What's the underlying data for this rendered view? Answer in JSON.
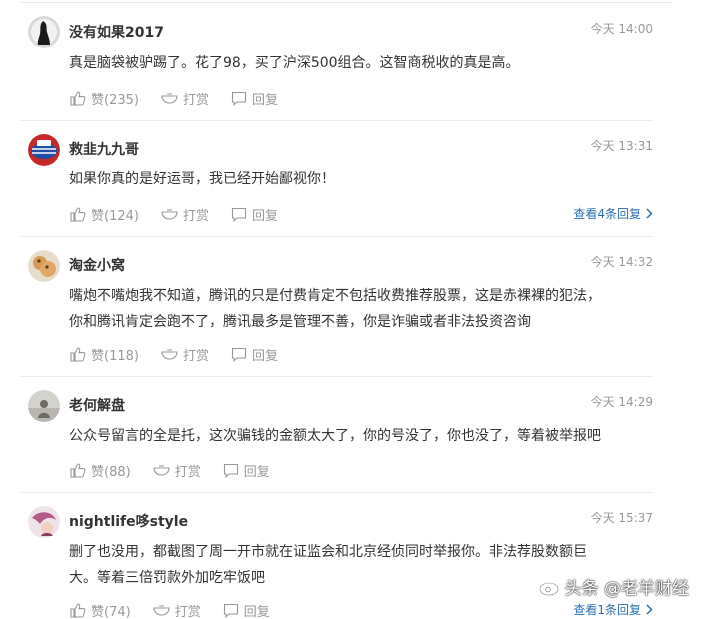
{
  "comments": [
    {
      "username": "没有如果2017",
      "time": "今天 14:00",
      "content": "真是脑袋被驴踢了。花了98，买了沪深500组合。这智商税收的真是高。",
      "like_label": "赞(235)",
      "reward_label": "打赏",
      "reply_label": "回复"
    },
    {
      "username": "救韭九九哥",
      "time": "今天 13:31",
      "content": "如果你真的是好运哥，我已经开始鄙视你！",
      "like_label": "赞(124)",
      "reward_label": "打赏",
      "reply_label": "回复",
      "view_replies": "查看4条回复"
    },
    {
      "username": "淘金小窝",
      "time": "今天 14:32",
      "content_lines": [
        "嘴炮不嘴炮我不知道，腾讯的只是付费肯定不包括收费推荐股票，这是赤裸裸的犯法，",
        "你和腾讯肯定会跑不了，腾讯最多是管理不善，你是诈骗或者非法投资咨询"
      ],
      "like_label": "赞(118)",
      "reward_label": "打赏",
      "reply_label": "回复"
    },
    {
      "username": "老何解盘",
      "time": "今天 14:29",
      "content": "公众号留言的全是托，这次骗钱的金额太大了，你的号没了，你也没了，等着被举报吧",
      "like_label": "赞(88)",
      "reward_label": "打赏",
      "reply_label": "回复"
    },
    {
      "username": "nightlife哆style",
      "time": "今天 15:37",
      "content_lines": [
        "删了也没用，都截图了周一开市就在证监会和北京经侦同时举报你。非法荐股数额巨",
        "大。等着三倍罚款外加吃牢饭吧"
      ],
      "like_label": "赞(74)",
      "reward_label": "打赏",
      "reply_label": "回复",
      "view_replies": "查看1条回复"
    }
  ],
  "watermark": {
    "text": "头条 @老羊财经"
  },
  "icons": {
    "like": "thumbs-up-icon",
    "reward": "tip-bowl-icon",
    "reply": "speech-bubble-icon",
    "arrow": "chevron-right-icon",
    "watermark": "weibo-logo-icon"
  },
  "colors": {
    "link": "#2a6fb0",
    "meta": "#999999",
    "text": "#333333"
  }
}
